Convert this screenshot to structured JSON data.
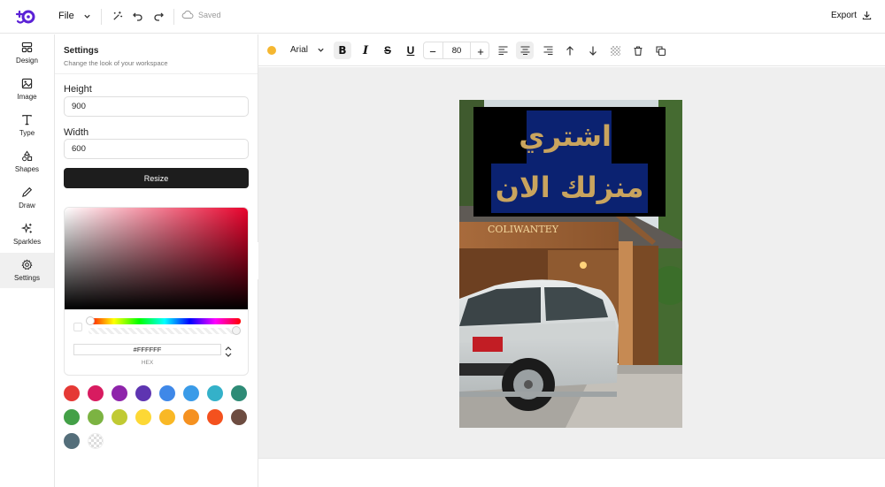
{
  "app": {
    "file_label": "File",
    "saved_label": "Saved",
    "export_label": "Export"
  },
  "nav": {
    "items": [
      {
        "label": "Design",
        "icon": "layout-icon"
      },
      {
        "label": "Image",
        "icon": "image-icon"
      },
      {
        "label": "Type",
        "icon": "type-icon"
      },
      {
        "label": "Shapes",
        "icon": "shapes-icon"
      },
      {
        "label": "Draw",
        "icon": "pencil-icon"
      },
      {
        "label": "Sparkles",
        "icon": "sparkles-icon"
      },
      {
        "label": "Settings",
        "icon": "gear-icon",
        "active": true
      }
    ]
  },
  "settings": {
    "title": "Settings",
    "subtitle": "Change the look of your workspace",
    "height_label": "Height",
    "height_value": "900",
    "width_label": "Width",
    "width_value": "600",
    "resize_label": "Resize",
    "hex_value": "#FFFFFF",
    "hex_label": "HEX",
    "swatches": [
      "#e53935",
      "#d81b60",
      "#8e24aa",
      "#5e35b1",
      "#3f88e8",
      "#3a9be8",
      "#34b1c9",
      "#2e8b76",
      "#43a047",
      "#7cb342",
      "#c0ca33",
      "#fdd835",
      "#f9b825",
      "#f59120",
      "#f4511e",
      "#6d4c41",
      "#546e7a",
      "transparent"
    ]
  },
  "toolbar": {
    "text_color": "#f5b731",
    "font_name": "Arial",
    "font_size": "80"
  },
  "canvas": {
    "text_line1": "اشتري",
    "text_line2": "منزلك الان",
    "sign_text": "COLIWANTEY"
  }
}
